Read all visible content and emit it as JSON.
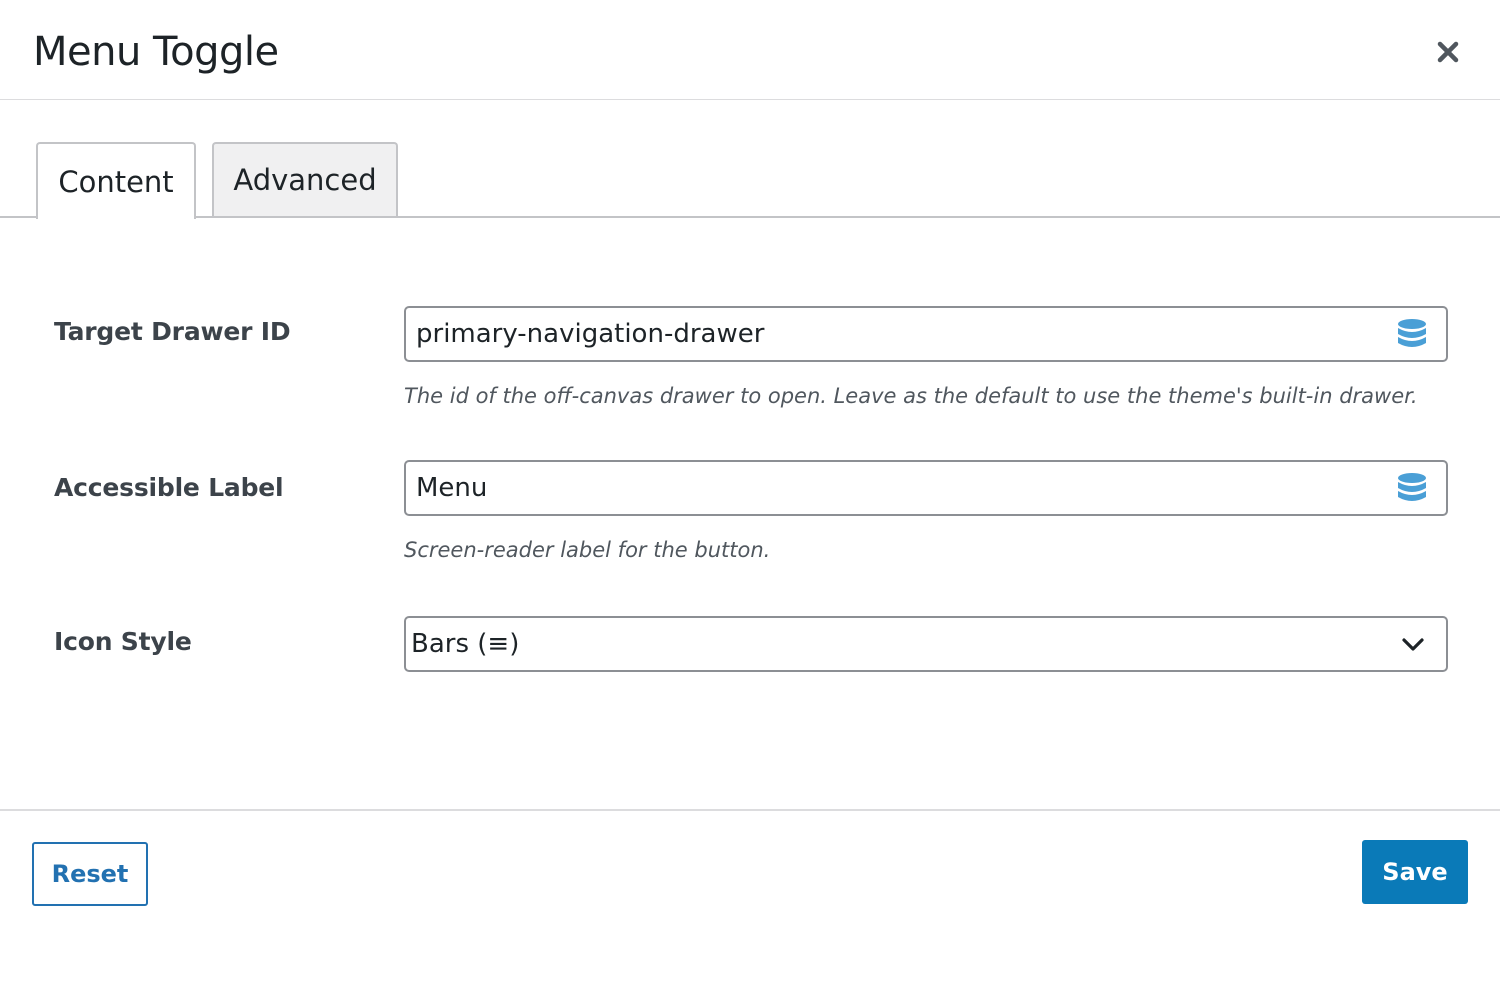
{
  "dialog": {
    "title": "Menu Toggle",
    "close_icon": "close-icon"
  },
  "tabs": [
    {
      "label": "Content",
      "active": true
    },
    {
      "label": "Advanced",
      "active": false
    }
  ],
  "fields": {
    "target_drawer_id": {
      "label": "Target Drawer ID",
      "value": "primary-navigation-drawer",
      "icon": "database-icon",
      "help": "The id of the off-canvas drawer to open. Leave as the default to use the theme's built-in drawer."
    },
    "accessible_label": {
      "label": "Accessible Label",
      "value": "Menu",
      "icon": "database-icon",
      "help": "Screen-reader label for the button."
    },
    "icon_style": {
      "label": "Icon Style",
      "selected": "Bars (≡)",
      "icon": "chevron-down-icon"
    }
  },
  "footer": {
    "reset_label": "Reset",
    "save_label": "Save"
  },
  "colors": {
    "accent": "#2271b1",
    "save_bg": "#0a7ab8",
    "db_icon": "#4a9fd6"
  }
}
